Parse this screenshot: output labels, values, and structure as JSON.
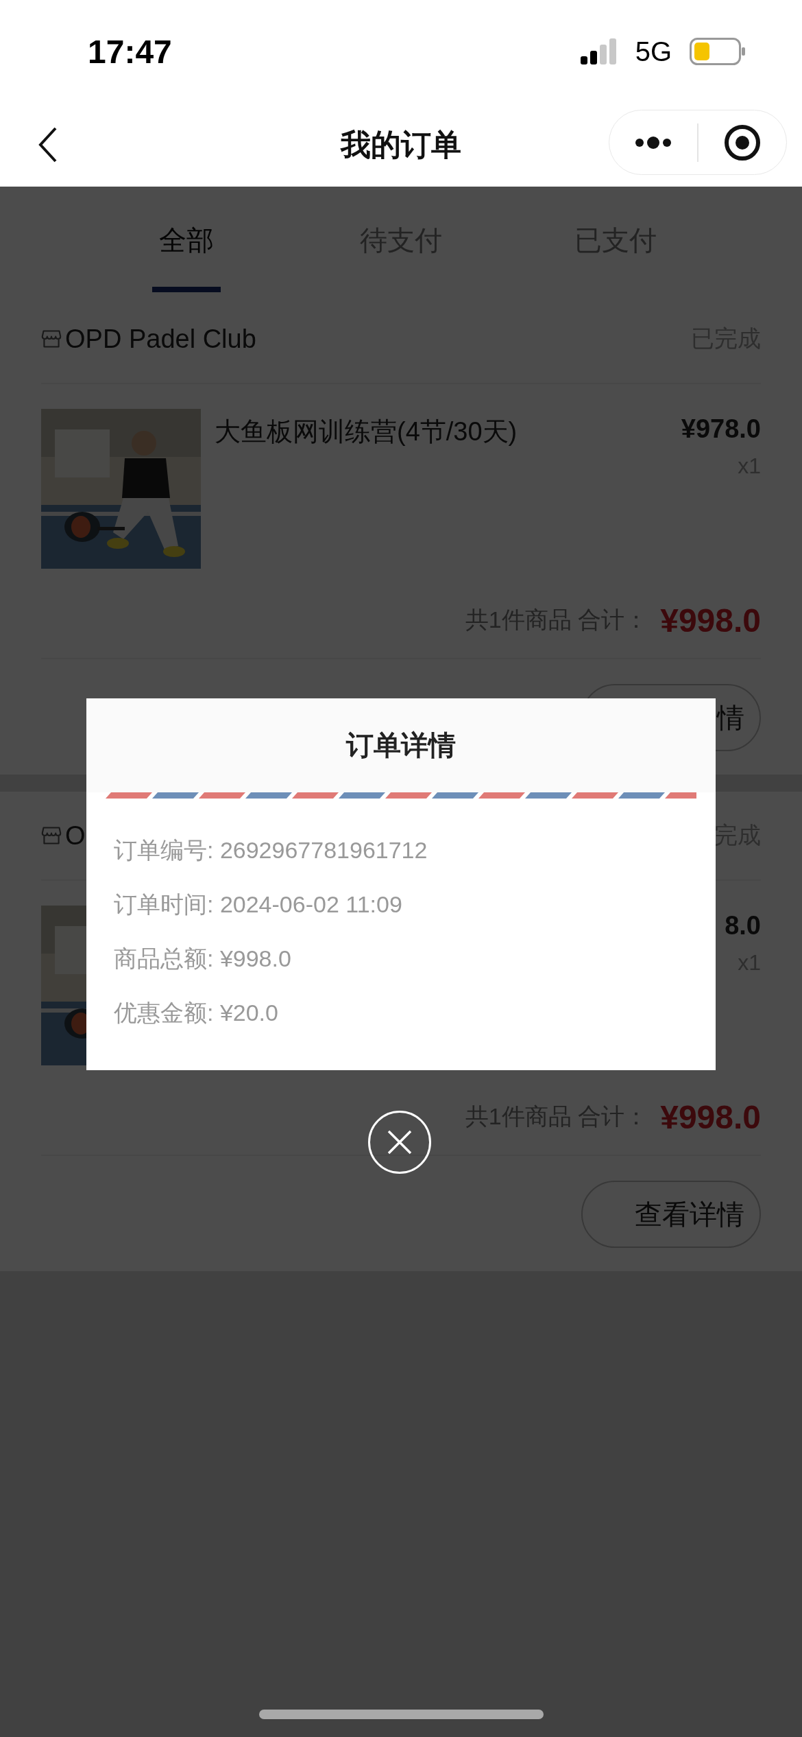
{
  "status_bar": {
    "time": "17:47",
    "network": "5G"
  },
  "nav": {
    "title": "我的订单"
  },
  "tabs": [
    {
      "label": "全部",
      "selected": true
    },
    {
      "label": "待支付",
      "selected": false
    },
    {
      "label": "已支付",
      "selected": false
    }
  ],
  "orders": [
    {
      "shop": "OPD Padel Club",
      "status": "已完成",
      "product": "大鱼板网训练营(4节/30天)",
      "price": "¥978.0",
      "quantity": "x1",
      "summary": "共1件商品 合计：",
      "total": "¥998.0",
      "button": "情"
    },
    {
      "shop": "O",
      "status": "完成",
      "price": "8.0",
      "quantity": "x1",
      "summary": "共1件商品 合计：",
      "total": "¥998.0",
      "button": "查看详情"
    }
  ],
  "dialog": {
    "title": "订单详情",
    "rows": [
      "订单编号: 2692967781961712",
      "订单时间: 2024-06-02 11:09",
      "商品总额: ¥998.0",
      "优惠金额: ¥20.0"
    ]
  }
}
